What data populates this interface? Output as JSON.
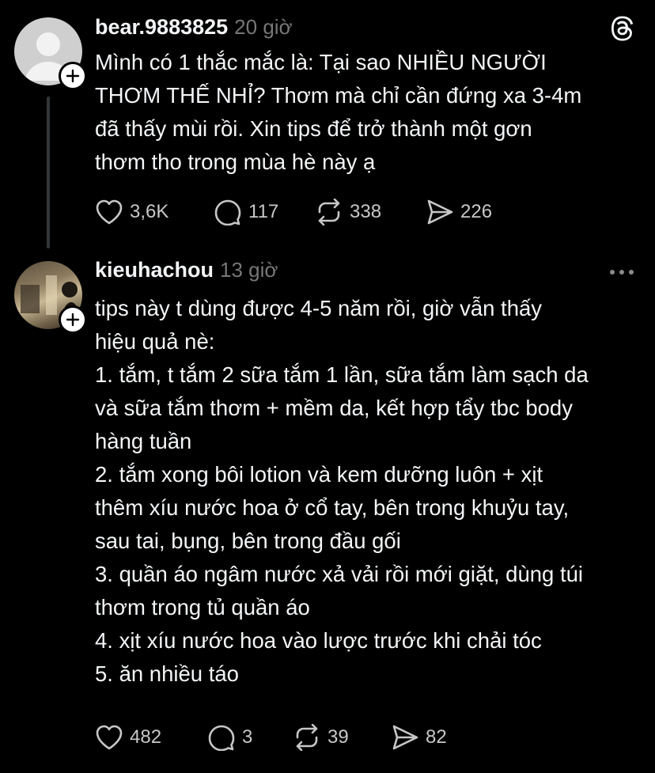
{
  "posts": [
    {
      "username": "bear.9883825",
      "time": "20 giờ",
      "avatar_icon": "default-avatar-icon",
      "lines": [
        "Mình có 1 thắc mắc là: Tại sao NHIỀU NGƯỜI",
        "THƠM THẾ NHỈ? Thơm mà chỉ cần đứng xa 3-4m",
        "đã thấy mùi rồi. Xin tips để trở thành một gơn",
        "thơm tho trong mùa hè này ạ"
      ],
      "likes": "3,6K",
      "comments": "117",
      "reposts": "338",
      "shares": "226"
    },
    {
      "username": "kieuhachou",
      "time": "13 giờ",
      "avatar_icon": "photo-avatar-icon",
      "lines": [
        "tips này t dùng được 4-5 năm rồi, giờ vẫn thấy",
        "hiệu quả nè:",
        "1. tắm, t tắm 2 sữa tắm 1 lần, sữa tắm làm sạch da",
        "và sữa tắm thơm + mềm da, kết hợp tẩy tbc body",
        "hàng tuần",
        "2. tắm xong bôi lotion và kem dưỡng luôn + xịt",
        "thêm xíu nước hoa ở cổ tay, bên trong khuỷu tay,",
        "sau tai, bụng, bên trong đầu gối",
        "3. quần áo ngâm nước xả vải rồi mới giặt, dùng túi",
        "thơm trong tủ quần áo",
        "4. xịt xíu nước hoa vào lược trước khi chải tóc",
        "5. ăn nhiều táo"
      ],
      "likes": "482",
      "comments": "3",
      "reposts": "39",
      "shares": "82"
    }
  ],
  "colors": {
    "background": "#000000",
    "text": "#f3f5f7",
    "muted": "#777777",
    "icon": "#c7c7c7",
    "thread_line": "#333638"
  },
  "icons": {
    "app": "threads-logo-icon",
    "more": "more-options-icon",
    "follow": "plus-icon",
    "like": "heart-icon",
    "comment": "comment-icon",
    "repost": "repost-icon",
    "share": "send-icon"
  }
}
